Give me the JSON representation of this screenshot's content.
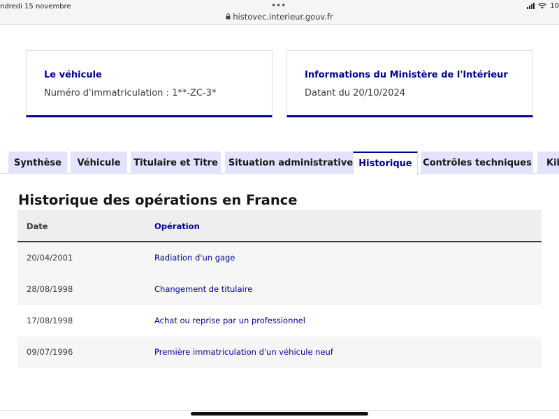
{
  "statusbar": {
    "date": "ndredi 15 novembre",
    "dots": "•••",
    "url": "histovec.interieur.gouv.fr",
    "battery": "10"
  },
  "icons": {
    "lock": "lock-icon",
    "signal": "cellular-signal-icon",
    "wifi": "wifi-icon"
  },
  "cards": [
    {
      "title": "Le véhicule",
      "text": "Numéro d'immatriculation : 1**-ZC-3*"
    },
    {
      "title": "Informations du Ministère de l'Intérieur",
      "text": "Datant du 20/10/2024"
    }
  ],
  "tabs": [
    {
      "label": "Synthèse",
      "active": false
    },
    {
      "label": "Véhicule",
      "active": false
    },
    {
      "label": "Titulaire et Titre",
      "active": false
    },
    {
      "label": "Situation administrative",
      "active": false
    },
    {
      "label": "Historique",
      "active": true
    },
    {
      "label": "Contrôles techniques",
      "active": false
    },
    {
      "label": "Kil",
      "active": false
    }
  ],
  "section": {
    "title": "Historique des opérations en France",
    "columns": [
      "Date",
      "Opération"
    ],
    "rows": [
      {
        "date": "20/04/2001",
        "operation": "Radiation d'un gage"
      },
      {
        "date": "28/08/1998",
        "operation": "Changement de titulaire"
      },
      {
        "date": "17/08/1998",
        "operation": "Achat ou reprise par un professionnel"
      },
      {
        "date": "09/07/1996",
        "operation": "Première immatriculation d'un véhicule neuf"
      }
    ]
  },
  "colors": {
    "brand_blue": "#000091",
    "tab_background": "#e3e3fd",
    "header_background": "#eeeeee"
  }
}
